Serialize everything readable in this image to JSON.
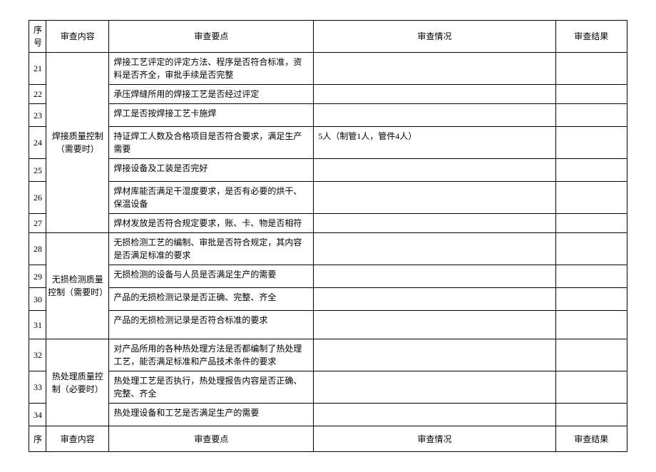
{
  "headers": {
    "num": "序号",
    "content": "审查内容",
    "keypoints": "审查要点",
    "situation": "审查情况",
    "result": "审查结果"
  },
  "groups": [
    {
      "category": "焊接质量控制（需要时）",
      "rows": [
        {
          "num": "21",
          "keypt": "焊接工艺评定的评定方法、程序是否符合标准，资料是否齐全，审批手续是否完整",
          "sit": "",
          "res": ""
        },
        {
          "num": "22",
          "keypt": "承压焊缝所用的焊接工艺是否经过评定",
          "sit": "",
          "res": ""
        },
        {
          "num": "23",
          "keypt": "焊工是否按焊接工艺卡施焊",
          "sit": "",
          "res": ""
        },
        {
          "num": "24",
          "keypt": "持证焊工人数及合格项目是否符合要求，满足生产需要",
          "sit": "5人（制管1人，管件4人）",
          "res": ""
        },
        {
          "num": "25",
          "keypt": "焊接设备及工装是否完好",
          "sit": "",
          "res": ""
        },
        {
          "num": "26",
          "keypt": "焊材库能否满足干湿度要求，是否有必要的烘干、保温设备",
          "sit": "",
          "res": ""
        },
        {
          "num": "27",
          "keypt": "焊材发放是否符合规定要求，账、卡、物是否相符",
          "sit": "",
          "res": ""
        }
      ]
    },
    {
      "category": "无损检测质量控制（需要时）",
      "rows": [
        {
          "num": "28",
          "keypt": "无损检测工艺的编制、审批是否符合规定，其内容是否满足标准的要求",
          "sit": "",
          "res": ""
        },
        {
          "num": "29",
          "keypt": "无损检测的设备与人员是否满足生产的需要",
          "sit": "",
          "res": ""
        },
        {
          "num": "30",
          "keypt": "产品的无损检测记录是否正确、完整、齐全",
          "sit": "",
          "res": ""
        },
        {
          "num": "31",
          "keypt": "产品的无损检测记录是否符合标准的要求",
          "sit": "",
          "res": ""
        }
      ]
    },
    {
      "category": "热处理质量控制（必要时）",
      "rows": [
        {
          "num": "32",
          "keypt": "对产品所用的各种热处理方法是否都编制了热处理工艺，能否满足标准和产品技术条件的要求",
          "sit": "",
          "res": ""
        },
        {
          "num": "33",
          "keypt": "热处理工艺是否执行，热处理报告内容是否正确、完整、齐全",
          "sit": "",
          "res": ""
        },
        {
          "num": "34",
          "keypt": "热处理设备和工艺是否满足生产的需要",
          "sit": "",
          "res": ""
        }
      ]
    }
  ],
  "footer": {
    "num": "序",
    "content": "审查内容",
    "keypoints": "审查要点",
    "situation": "审查情况",
    "result": "审查结果"
  }
}
